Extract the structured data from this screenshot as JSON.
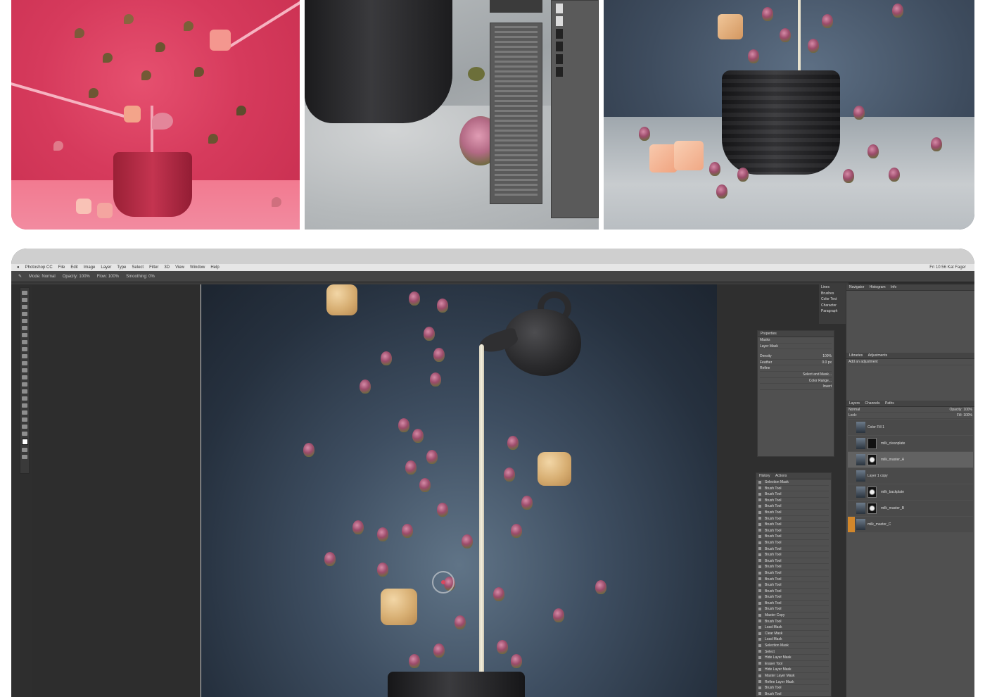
{
  "collage": {
    "top_thumbnails": [
      "red-backdrop-render",
      "photoshop-closeup",
      "final-blue-render"
    ]
  },
  "ps": {
    "watermark": "",
    "menubar": {
      "app": "Photoshop CC",
      "items": [
        "File",
        "Edit",
        "Image",
        "Layer",
        "Type",
        "Select",
        "Filter",
        "3D",
        "View",
        "Window",
        "Help"
      ],
      "right_status": "Fri 10:56  Kat Fager"
    },
    "options": [
      "Mode: Normal",
      "Opacity: 100%",
      "Flow: 100%",
      "Smoothing: 0%"
    ],
    "tools_panel": {
      "items": [
        "Lines",
        "Brushes",
        "Color Text",
        "Character",
        "Paragraph"
      ]
    },
    "properties": {
      "title": "Properties",
      "mode": "Masks",
      "layer_mask": "Layer Mask",
      "density": "Density",
      "density_value": "100%",
      "feather": "Feather",
      "feather_value": "0.0 px",
      "refine": "Refine",
      "select_and_mask": "Select and Mask...",
      "color_range": "Color Range...",
      "invert": "Invert"
    },
    "history": {
      "tabs": [
        "History",
        "Actions"
      ],
      "items": [
        "Selection Mask",
        "Brush Tool",
        "Brush Tool",
        "Brush Tool",
        "Brush Tool",
        "Brush Tool",
        "Brush Tool",
        "Brush Tool",
        "Brush Tool",
        "Brush Tool",
        "Brush Tool",
        "Brush Tool",
        "Brush Tool",
        "Brush Tool",
        "Brush Tool",
        "Brush Tool",
        "Brush Tool",
        "Brush Tool",
        "Brush Tool",
        "Brush Tool",
        "Brush Tool",
        "Brush Tool",
        "Master Copy",
        "Brush Tool",
        "Load Mask",
        "Clear Mask",
        "Load Mask",
        "Selection Mask",
        "Select",
        "Hide Layer Mask",
        "Eraser Tool",
        "Hide Layer Mask",
        "Master Layer Mask",
        "Refine Layer Mask",
        "Brush Tool",
        "Brush Tool"
      ]
    },
    "right": {
      "tabs": [
        "Navigator",
        "Histogram",
        "Info"
      ],
      "adjust_tabs": [
        "Libraries",
        "Adjustments"
      ],
      "adjust_label": "Add an adjustment",
      "layer_tabs": [
        "Layers",
        "Channels",
        "Paths"
      ],
      "blend": "Normal",
      "opacity": "Opacity: 100%",
      "lock": "Lock:",
      "fill": "Fill: 100%",
      "layers": [
        "Color Fill 1",
        "milk_cleanplate",
        "milk_master_A",
        "Layer 1 copy",
        "milk_backplate",
        "milk_master_B",
        "milk_master_C"
      ]
    }
  }
}
